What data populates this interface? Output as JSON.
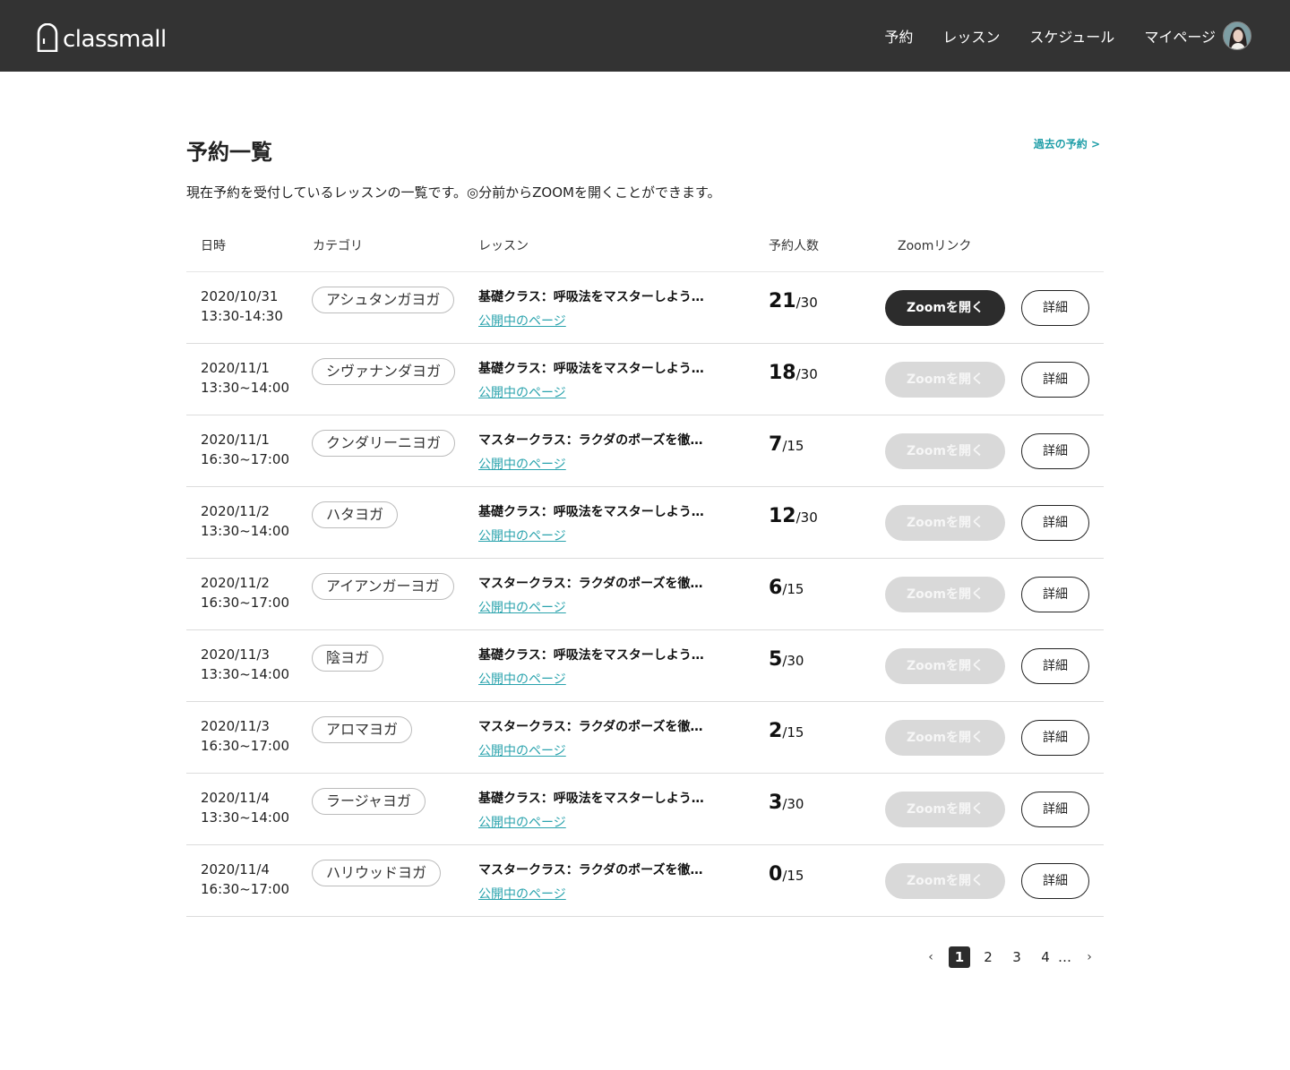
{
  "header": {
    "brand": "classmall",
    "nav": [
      "予約",
      "レッスン",
      "スケジュール",
      "マイページ"
    ]
  },
  "page": {
    "title": "予約一覧",
    "past_link": "過去の予約 >",
    "description": "現在予約を受付しているレッスンの一覧です。◎分前からZOOMを開くことができます。"
  },
  "table": {
    "headers": {
      "date": "日時",
      "category": "カテゴリ",
      "lesson": "レッスン",
      "count": "予約人数",
      "zoom": "Zoomリンク"
    },
    "rows": [
      {
        "date": "2020/10/31",
        "time": "13:30-14:30",
        "category": "アシュタンガヨガ",
        "lesson": "基礎クラス：呼吸法をマスターしよう…",
        "link": "公開中のページ",
        "booked": "21",
        "capacity": "/30",
        "zoom_label": "Zoomを開く",
        "zoom_active": true,
        "detail": "詳細"
      },
      {
        "date": "2020/11/1",
        "time": "13:30~14:00",
        "category": "シヴァナンダヨガ",
        "lesson": "基礎クラス：呼吸法をマスターしよう…",
        "link": "公開中のページ",
        "booked": "18",
        "capacity": "/30",
        "zoom_label": "Zoomを開く",
        "zoom_active": false,
        "detail": "詳細"
      },
      {
        "date": "2020/11/1",
        "time": "16:30~17:00",
        "category": "クンダリーニヨガ",
        "lesson": "マスタークラス：ラクダのポーズを徹…",
        "link": "公開中のページ",
        "booked": "7",
        "capacity": "/15",
        "zoom_label": "Zoomを開く",
        "zoom_active": false,
        "detail": "詳細"
      },
      {
        "date": "2020/11/2",
        "time": "13:30~14:00",
        "category": "ハタヨガ",
        "lesson": "基礎クラス：呼吸法をマスターしよう…",
        "link": "公開中のページ",
        "booked": "12",
        "capacity": "/30",
        "zoom_label": "Zoomを開く",
        "zoom_active": false,
        "detail": "詳細"
      },
      {
        "date": "2020/11/2",
        "time": "16:30~17:00",
        "category": "アイアンガーヨガ",
        "lesson": "マスタークラス：ラクダのポーズを徹…",
        "link": "公開中のページ",
        "booked": "6",
        "capacity": "/15",
        "zoom_label": "Zoomを開く",
        "zoom_active": false,
        "detail": "詳細"
      },
      {
        "date": "2020/11/3",
        "time": "13:30~14:00",
        "category": "陰ヨガ",
        "lesson": "基礎クラス：呼吸法をマスターしよう…",
        "link": "公開中のページ",
        "booked": "5",
        "capacity": "/30",
        "zoom_label": "Zoomを開く",
        "zoom_active": false,
        "detail": "詳細"
      },
      {
        "date": "2020/11/3",
        "time": "16:30~17:00",
        "category": "アロマヨガ",
        "lesson": "マスタークラス：ラクダのポーズを徹…",
        "link": "公開中のページ",
        "booked": "2",
        "capacity": "/15",
        "zoom_label": "Zoomを開く",
        "zoom_active": false,
        "detail": "詳細"
      },
      {
        "date": "2020/11/4",
        "time": "13:30~14:00",
        "category": "ラージャヨガ",
        "lesson": "基礎クラス：呼吸法をマスターしよう…",
        "link": "公開中のページ",
        "booked": "3",
        "capacity": "/30",
        "zoom_label": "Zoomを開く",
        "zoom_active": false,
        "detail": "詳細"
      },
      {
        "date": "2020/11/4",
        "time": "16:30~17:00",
        "category": "ハリウッドヨガ",
        "lesson": "マスタークラス：ラクダのポーズを徹…",
        "link": "公開中のページ",
        "booked": "0",
        "capacity": "/15",
        "zoom_label": "Zoomを開く",
        "zoom_active": false,
        "detail": "詳細"
      }
    ]
  },
  "pagination": {
    "prev": "‹",
    "pages": [
      "1",
      "2",
      "3",
      "4"
    ],
    "current": "1",
    "ellipsis": "…",
    "next": "›"
  },
  "colors": {
    "header_bg": "#333333",
    "accent_link": "#2aa3ad",
    "zoom_active_bg": "#2c2c2c",
    "zoom_inactive_bg": "#d9d9d9"
  },
  "icons": {
    "logo": "door-arch-icon",
    "avatar": "user-avatar",
    "prev": "chevron-left-icon",
    "next": "chevron-right-icon"
  }
}
